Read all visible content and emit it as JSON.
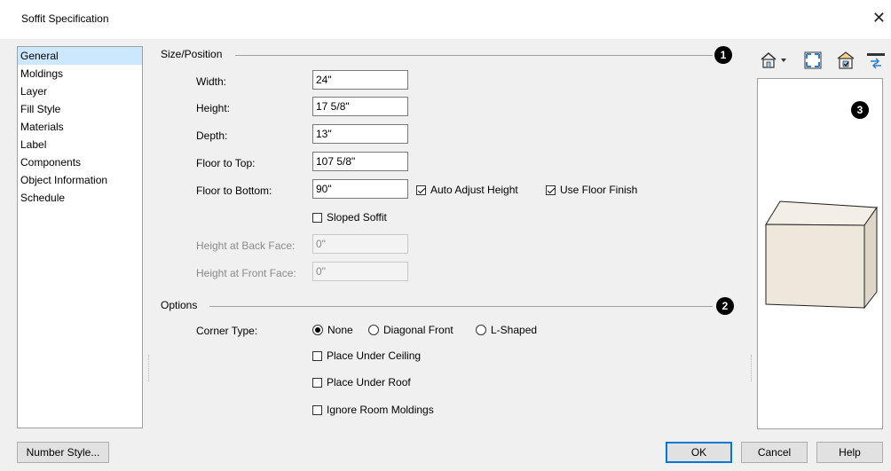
{
  "window": {
    "title": "Soffit Specification",
    "close_glyph": "✕"
  },
  "nav": {
    "items": [
      "General",
      "Moldings",
      "Layer",
      "Fill Style",
      "Materials",
      "Label",
      "Components",
      "Object Information",
      "Schedule"
    ],
    "selected": 0
  },
  "size_position": {
    "header": "Size/Position",
    "badge": "1",
    "width": {
      "label": "Width:",
      "value": "24\""
    },
    "height": {
      "label": "Height:",
      "value": "17 5/8\""
    },
    "depth": {
      "label": "Depth:",
      "value": "13\""
    },
    "floor_to_top": {
      "label": "Floor to Top:",
      "value": "107 5/8\""
    },
    "floor_to_bottom": {
      "label": "Floor to Bottom:",
      "value": "90\""
    },
    "auto_adjust_height": {
      "label": "Auto Adjust Height",
      "checked": true
    },
    "use_floor_finish": {
      "label": "Use Floor Finish",
      "checked": true
    },
    "sloped_soffit": {
      "label": "Sloped Soffit",
      "checked": false
    },
    "height_back_face": {
      "label": "Height at Back Face:",
      "value": "0\""
    },
    "height_front_face": {
      "label": "Height at Front Face:",
      "value": "0\""
    }
  },
  "options": {
    "header": "Options",
    "badge": "2",
    "corner_type": {
      "label": "Corner Type:",
      "choices": [
        "None",
        "Diagonal Front",
        "L-Shaped"
      ],
      "selected": "None"
    },
    "place_under_ceiling": {
      "label": "Place Under Ceiling",
      "checked": false
    },
    "place_under_roof": {
      "label": "Place Under Roof",
      "checked": false
    },
    "ignore_room_moldings": {
      "label": "Ignore Room Moldings",
      "checked": false
    }
  },
  "preview": {
    "badge": "3",
    "fill_color": "#ede7dc"
  },
  "toolbar": {
    "icons": [
      "camera-view-dropdown-icon",
      "fill-window-icon",
      "render-preview-icon",
      "swap-view-icon"
    ]
  },
  "footer": {
    "number_style": "Number Style...",
    "ok": "OK",
    "cancel": "Cancel",
    "help": "Help"
  }
}
